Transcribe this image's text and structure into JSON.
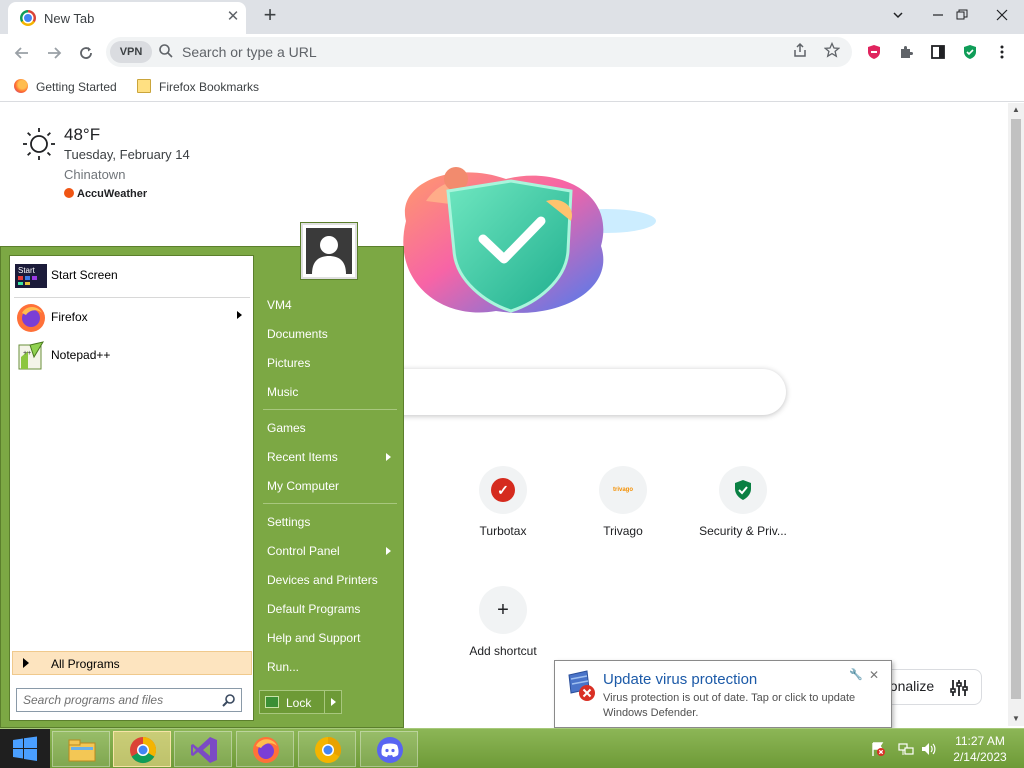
{
  "browser": {
    "tab_title": "New Tab",
    "tab_close": "✕",
    "new_tab": "+",
    "omnibox_placeholder": "Search or type a URL",
    "vpn_label": "VPN",
    "bookmarks": [
      {
        "label": "Getting Started",
        "icon": "firefox-icon"
      },
      {
        "label": "Firefox Bookmarks",
        "icon": "folder-icon"
      }
    ]
  },
  "weather": {
    "temperature": "48°F",
    "date": "Tuesday, February 14",
    "location": "Chinatown",
    "provider": "AccuWeather"
  },
  "shortcuts": [
    {
      "label": "Turbotax",
      "icon": "turbotax-check-icon",
      "color": "#d52b1e"
    },
    {
      "label": "Trivago",
      "icon": "trivago-icon",
      "color": "#f48f00"
    },
    {
      "label": "Security & Priv...",
      "icon": "shield-check-icon",
      "color": "#0a8043"
    },
    {
      "label": "Add shortcut",
      "icon": "plus-icon",
      "color": "#202124"
    }
  ],
  "personalize_label": "Personalize",
  "start_menu": {
    "pinned": [
      {
        "label": "Start Screen",
        "icon": "start-screen-icon",
        "icon_text": "Start"
      },
      {
        "label": "Firefox",
        "icon": "firefox-icon",
        "has_submenu": true
      },
      {
        "label": "Notepad++",
        "icon": "notepadpp-icon"
      }
    ],
    "all_programs": "All Programs",
    "search_placeholder": "Search programs and files",
    "right_items": [
      {
        "label": "VM4"
      },
      {
        "label": "Documents"
      },
      {
        "label": "Pictures"
      },
      {
        "label": "Music"
      },
      {
        "label": "Games"
      },
      {
        "label": "Recent Items",
        "has_submenu": true
      },
      {
        "label": "My Computer"
      },
      {
        "label": "Settings"
      },
      {
        "label": "Control Panel",
        "has_submenu": true
      },
      {
        "label": "Devices and Printers"
      },
      {
        "label": "Default Programs"
      },
      {
        "label": "Help and Support"
      },
      {
        "label": "Run..."
      }
    ],
    "lock_label": "Lock"
  },
  "notification": {
    "title": "Update virus protection",
    "body": "Virus protection is out of date. Tap or click to update Windows Defender.",
    "close": "✕"
  },
  "taskbar": {
    "apps": [
      {
        "name": "file-explorer-icon"
      },
      {
        "name": "chrome-icon",
        "active": true
      },
      {
        "name": "visual-studio-icon"
      },
      {
        "name": "firefox-icon"
      },
      {
        "name": "chrome-canary-icon"
      },
      {
        "name": "discord-icon"
      }
    ],
    "time": "11:27 AM",
    "date": "2/14/2023"
  },
  "colors": {
    "start_menu_green": "#7ca844",
    "taskbar_green": "#7aa640",
    "balloon_title": "#1c5aa8",
    "shield_teal": "#2cc5a0"
  }
}
